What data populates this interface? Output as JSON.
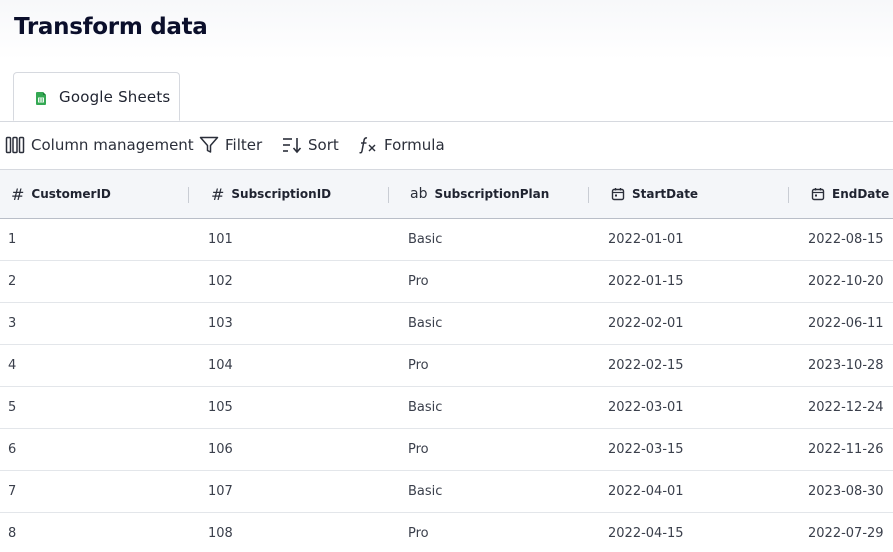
{
  "page": {
    "title": "Transform data"
  },
  "tabs": [
    {
      "label": "Google Sheets",
      "icon": "google-sheets-icon",
      "active": true,
      "color": "#34a853"
    }
  ],
  "toolbar": {
    "column_management": "Column management",
    "filter": "Filter",
    "sort": "Sort",
    "formula": "Formula"
  },
  "table": {
    "columns": [
      {
        "label": "CustomerID",
        "type_icon": "number-hash-icon"
      },
      {
        "label": "SubscriptionID",
        "type_icon": "number-hash-icon"
      },
      {
        "label": "SubscriptionPlan",
        "type_icon": "text-ab-icon"
      },
      {
        "label": "StartDate",
        "type_icon": "calendar-icon"
      },
      {
        "label": "EndDate",
        "type_icon": "calendar-icon"
      }
    ],
    "rows": [
      [
        "1",
        "101",
        "Basic",
        "2022-01-01",
        "2022-08-15"
      ],
      [
        "2",
        "102",
        "Pro",
        "2022-01-15",
        "2022-10-20"
      ],
      [
        "3",
        "103",
        "Basic",
        "2022-02-01",
        "2022-06-11"
      ],
      [
        "4",
        "104",
        "Pro",
        "2022-02-15",
        "2023-10-28"
      ],
      [
        "5",
        "105",
        "Basic",
        "2022-03-01",
        "2022-12-24"
      ],
      [
        "6",
        "106",
        "Pro",
        "2022-03-15",
        "2022-11-26"
      ],
      [
        "7",
        "107",
        "Basic",
        "2022-04-01",
        "2023-08-30"
      ],
      [
        "8",
        "108",
        "Pro",
        "2022-04-15",
        "2022-07-29"
      ]
    ]
  },
  "icon_glyphs": {
    "hash": "#",
    "ab": "ab"
  }
}
